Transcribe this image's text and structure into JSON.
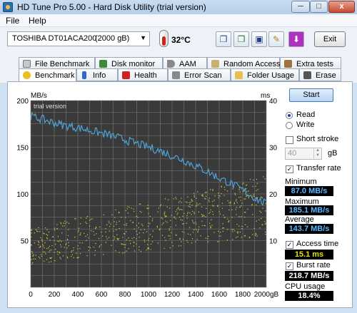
{
  "window": {
    "title": "HD Tune Pro 5.00 - Hard Disk Utility (trial version)",
    "min_label": "─",
    "max_label": "□",
    "close_label": "x"
  },
  "menu": {
    "items": [
      "File",
      "Help"
    ]
  },
  "toolbar": {
    "drive_name": "TOSHIBA DT01ACA200",
    "drive_size": "(2000 gB)",
    "temperature": "32°C",
    "exit_label": "Exit"
  },
  "tabs_top": [
    "File Benchmark",
    "Disk monitor",
    "AAM",
    "Random Access",
    "Extra tests"
  ],
  "tabs_bottom": [
    "Benchmark",
    "Info",
    "Health",
    "Error Scan",
    "Folder Usage",
    "Erase"
  ],
  "active_tab": "Benchmark",
  "panel": {
    "start_label": "Start",
    "read_label": "Read",
    "write_label": "Write",
    "mode": "Read",
    "short_stroke_label": "Short stroke",
    "short_stroke_checked": false,
    "short_stroke_value": "40",
    "short_stroke_unit": "gB",
    "transfer_rate_label": "Transfer rate",
    "transfer_rate_checked": true,
    "minimum_label": "Minimum",
    "minimum_value": "87.0 MB/s",
    "maximum_label": "Maximum",
    "maximum_value": "185.1 MB/s",
    "average_label": "Average",
    "average_value": "143.7 MB/s",
    "access_time_label": "Access time",
    "access_time_checked": true,
    "access_time_value": "15.1 ms",
    "burst_rate_label": "Burst rate",
    "burst_rate_checked": true,
    "burst_rate_value": "218.7 MB/s",
    "cpu_label": "CPU usage",
    "cpu_value": "18.4%"
  },
  "chart_data": {
    "type": "line",
    "watermark": "trial version",
    "ylabel_left": "MB/s",
    "ylabel_right": "ms",
    "x_unit": "gB",
    "xlim": [
      0,
      2000
    ],
    "ylim_left": [
      0,
      200
    ],
    "ylim_right": [
      0,
      40
    ],
    "x_ticks": [
      0,
      200,
      400,
      600,
      800,
      1000,
      1200,
      1400,
      1600,
      1800,
      2000
    ],
    "y_ticks_left": [
      50,
      100,
      150,
      200
    ],
    "y_ticks_right": [
      10,
      20,
      30,
      40
    ],
    "grid": true,
    "series": [
      {
        "name": "Transfer rate",
        "axis": "left",
        "color": "#4fa3d8",
        "x": [
          0,
          100,
          200,
          300,
          400,
          500,
          600,
          700,
          800,
          900,
          1000,
          1100,
          1200,
          1300,
          1400,
          1500,
          1600,
          1700,
          1800,
          1900,
          2000
        ],
        "values": [
          183,
          180,
          176,
          173,
          171,
          168,
          165,
          162,
          158,
          154,
          150,
          146,
          141,
          136,
          130,
          124,
          117,
          111,
          104,
          96,
          89
        ]
      },
      {
        "name": "Access time",
        "axis": "right",
        "color": "#d8d040",
        "kind": "scatter",
        "range_start": [
          5,
          13
        ],
        "range_end": [
          11,
          24
        ],
        "count": 650
      }
    ]
  },
  "colors": {
    "plot_bg": "#3a3a3a",
    "grid": "#7a7a7a",
    "rate": "#4fa3d8",
    "access": "#d8d040"
  }
}
